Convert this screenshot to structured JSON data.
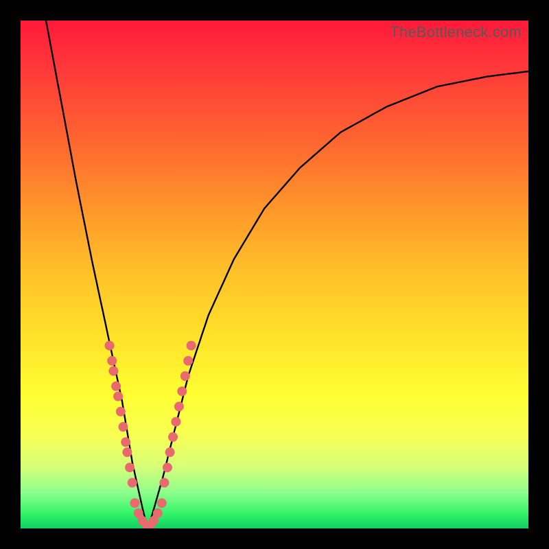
{
  "watermark": "TheBottleneck.com",
  "chart_data": {
    "type": "line",
    "title": "",
    "xlabel": "",
    "ylabel": "",
    "xlim": [
      0,
      100
    ],
    "ylim": [
      0,
      100
    ],
    "gradient_meaning": "background color represents bottleneck severity: red = high, yellow = medium, green = none",
    "curve_note": "V-shaped curve; minimum (0% bottleneck) near x≈25; rises toward 100% at x→0 and x→100",
    "series": [
      {
        "name": "bottleneck-curve",
        "x": [
          5,
          8,
          11,
          14,
          17,
          20,
          22,
          24,
          25,
          26,
          28,
          30,
          33,
          37,
          42,
          48,
          55,
          63,
          72,
          82,
          92,
          100
        ],
        "y": [
          100,
          84,
          68,
          53,
          39,
          25,
          13,
          4,
          0,
          3,
          10,
          18,
          30,
          42,
          53,
          63,
          71,
          78,
          83,
          87,
          89,
          90
        ]
      },
      {
        "name": "sample-points-left",
        "x": [
          17.5,
          18.0,
          18.3,
          18.8,
          19.2,
          19.7,
          20.2,
          20.7,
          21.0,
          21.5,
          22.0
        ],
        "y": [
          36,
          33,
          31,
          28,
          26,
          23,
          20,
          17,
          15,
          12,
          9
        ]
      },
      {
        "name": "sample-points-bottom",
        "x": [
          22.5,
          23.2,
          24.0,
          24.8,
          25.5,
          26.2,
          27.0,
          27.8
        ],
        "y": [
          5,
          3,
          1.5,
          0.5,
          0.5,
          1.5,
          3,
          5
        ]
      },
      {
        "name": "sample-points-right",
        "x": [
          28.3,
          28.9,
          29.4,
          30.0,
          30.6,
          31.2,
          31.8,
          32.4,
          33.0,
          33.6
        ],
        "y": [
          9,
          12,
          15,
          18,
          21,
          24,
          27,
          30,
          33,
          36
        ]
      }
    ]
  }
}
